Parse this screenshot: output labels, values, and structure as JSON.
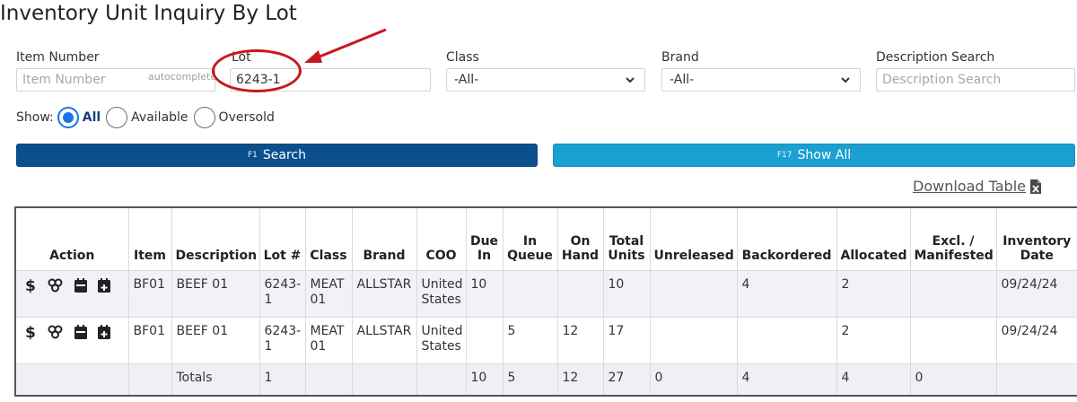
{
  "page": {
    "title": "Inventory Unit Inquiry By Lot"
  },
  "filters": {
    "item_number": {
      "label": "Item Number",
      "placeholder": "Item Number",
      "hint": "autocomplete"
    },
    "lot": {
      "label": "Lot",
      "value": "6243-1"
    },
    "class": {
      "label": "Class",
      "selected": "-All-"
    },
    "brand": {
      "label": "Brand",
      "selected": "-All-"
    },
    "description": {
      "label": "Description Search",
      "placeholder": "Description Search"
    },
    "show": {
      "label": "Show:",
      "options": [
        "All",
        "Available",
        "Oversold"
      ],
      "selected": "All"
    }
  },
  "buttons": {
    "search": {
      "key": "F1",
      "label": "Search",
      "color": "#0b4f8c"
    },
    "show_all": {
      "key": "F17",
      "label": "Show All",
      "color": "#1c9fd1"
    }
  },
  "download": {
    "label": "Download Table",
    "icon": "excel-file-icon"
  },
  "table": {
    "headers": {
      "action": "Action",
      "item": "Item",
      "description": "Description",
      "lot": "Lot #",
      "class": "Class",
      "brand": "Brand",
      "coo": "COO",
      "due_in_1": "Due",
      "due_in_2": "In",
      "in_queue_1": "In",
      "in_queue_2": "Queue",
      "on_hand_1": "On",
      "on_hand_2": "Hand",
      "total_units_1": "Total",
      "total_units_2": "Units",
      "unreleased": "Unreleased",
      "backordered": "Backordered",
      "allocated": "Allocated",
      "excl_1": "Excl. /",
      "excl_2": "Manifested",
      "inv_date_1": "Inventory",
      "inv_date_2": "Date"
    },
    "action_icons": [
      "dollar-icon",
      "link-icon",
      "calendar-icon",
      "calendar-add-icon"
    ],
    "rows": [
      {
        "item": "BF01",
        "description": "BEEF 01",
        "lot_1": "6243-",
        "lot_2": "1",
        "class_1": "MEAT",
        "class_2": "01",
        "brand": "ALLSTAR",
        "coo_1": "United",
        "coo_2": "States",
        "due_in": "10",
        "in_queue": "",
        "on_hand": "",
        "total_units": "10",
        "unreleased": "",
        "backordered": "4",
        "allocated": "2",
        "excl": "",
        "inventory_date": "09/24/24"
      },
      {
        "item": "BF01",
        "description": "BEEF 01",
        "lot_1": "6243-",
        "lot_2": "1",
        "class_1": "MEAT",
        "class_2": "01",
        "brand": "ALLSTAR",
        "coo_1": "United",
        "coo_2": "States",
        "due_in": "",
        "in_queue": "5",
        "on_hand": "12",
        "total_units": "17",
        "unreleased": "",
        "backordered": "",
        "allocated": "2",
        "excl": "",
        "inventory_date": "09/24/24"
      }
    ],
    "totals": {
      "label": "Totals",
      "lot": "1",
      "due_in": "10",
      "in_queue": "5",
      "on_hand": "12",
      "total_units": "27",
      "unreleased": "0",
      "backordered": "4",
      "allocated": "4",
      "excl": "0"
    }
  },
  "colors": {
    "annotation": "#c8161d",
    "radio_selected": "#1a73e8"
  }
}
